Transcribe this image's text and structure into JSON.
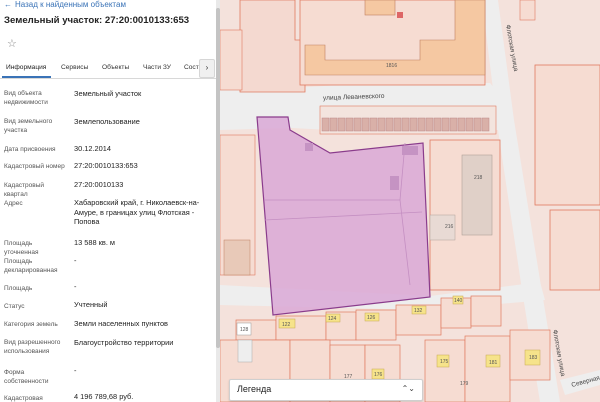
{
  "header": {
    "back_label": "Назад к найденным объектам",
    "title": "Земельный участок: 27:20:0010133:653"
  },
  "tabs": [
    "Информация",
    "Сервисы",
    "Объекты",
    "Части ЗУ",
    "Сост"
  ],
  "tab_next": "›",
  "fields": [
    {
      "label": "Вид объекта недвижимости",
      "value": "Земельный участок"
    },
    {
      "label": "Вид земельного участка",
      "value": "Землепользование"
    },
    {
      "label": "Дата присвоения",
      "value": "30.12.2014"
    },
    {
      "label": "Кадастровый номер",
      "value": "27:20:0010133:653"
    },
    {
      "label": "Кадастровый квартал",
      "value": "27:20:0010133"
    },
    {
      "label": "Адрес",
      "value": "Хабаровский край, г. Николаевск-на-Амуре, в границах улиц Флотская - Попова"
    },
    {
      "label": "Площадь уточненная",
      "value": "13 588 кв. м"
    },
    {
      "label": "Площадь декларированная",
      "value": "-"
    },
    {
      "label": "Площадь",
      "value": "-"
    },
    {
      "label": "Статус",
      "value": "Учтенный"
    },
    {
      "label": "Категория земель",
      "value": "Земли населенных пунктов"
    },
    {
      "label": "Вид разрешенного использования",
      "value": "Благоустройство территории"
    },
    {
      "label": "Форма собственности",
      "value": "-"
    },
    {
      "label": "Кадастровая",
      "value": "4 196 789,68 руб."
    }
  ],
  "map": {
    "streets": {
      "levanevskogo": "улица Леваневского",
      "flotskaya_top": "Флотская улица",
      "flotskaya_bottom": "Флотская улица",
      "severnaya": "Северная"
    },
    "numbers": [
      "1816",
      "218",
      "216",
      "128",
      "122",
      "124",
      "126",
      "132",
      "140",
      "177",
      "176",
      "175",
      "181",
      "179",
      "183"
    ],
    "colors": {
      "parcel_fill": "#d9a8d6",
      "parcel_border": "#8a3c8c",
      "boundary": "#e07a5f",
      "building": "#f5c8a2",
      "highlight": "#f6e38a"
    }
  },
  "legend": {
    "label": "Легенда",
    "control": "⌃⌄"
  }
}
